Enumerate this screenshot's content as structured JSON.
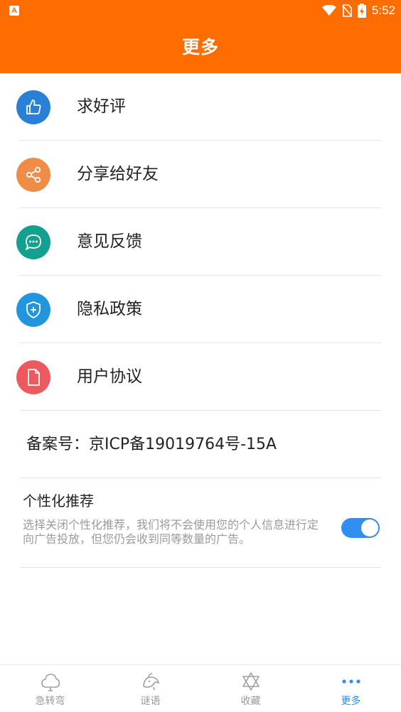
{
  "status_bar": {
    "time": "5:52",
    "notification_icon": "a-icon"
  },
  "header": {
    "title": "更多"
  },
  "menu": [
    {
      "label": "求好评",
      "icon": "thumbs-up-icon",
      "color": "#2a7fd6"
    },
    {
      "label": "分享给好友",
      "icon": "share-icon",
      "color": "#ef8d48"
    },
    {
      "label": "意见反馈",
      "icon": "feedback-icon",
      "color": "#14a08f"
    },
    {
      "label": "隐私政策",
      "icon": "shield-icon",
      "color": "#2196de"
    },
    {
      "label": "用户协议",
      "icon": "document-icon",
      "color": "#ec5a5f"
    }
  ],
  "icp": {
    "text": "备案号：京ICP备19019764号-15A"
  },
  "personalization": {
    "title": "个性化推荐",
    "description": "选择关闭个性化推荐，我们将不会使用您的个人信息进行定向广告投放，但您仍会收到同等数量的广告。",
    "enabled": true,
    "toggle_color": "#2f8ef0"
  },
  "tabs": [
    {
      "label": "急转弯",
      "icon": "cloud-icon",
      "active": false
    },
    {
      "label": "谜语",
      "icon": "bird-icon",
      "active": false
    },
    {
      "label": "收藏",
      "icon": "star-of-david-icon",
      "active": false
    },
    {
      "label": "更多",
      "icon": "more-dots-icon",
      "active": true
    }
  ],
  "colors": {
    "brand": "#ff6d00",
    "accent": "#2f8ef0"
  }
}
